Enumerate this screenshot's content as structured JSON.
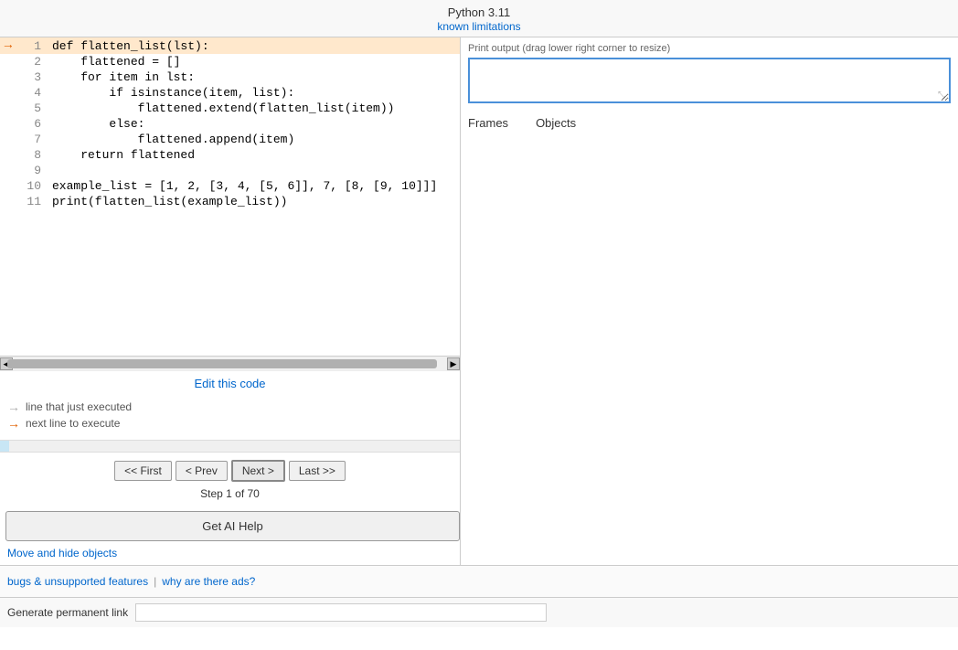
{
  "header": {
    "version": "Python 3.11",
    "known_limitations_link": "known limitations"
  },
  "code": {
    "lines": [
      {
        "num": 1,
        "code": "def flatten_list(lst):",
        "arrow": "→",
        "highlighted": true
      },
      {
        "num": 2,
        "code": "    flattened = []",
        "arrow": "",
        "highlighted": false
      },
      {
        "num": 3,
        "code": "    for item in lst:",
        "arrow": "",
        "highlighted": false
      },
      {
        "num": 4,
        "code": "        if isinstance(item, list):",
        "arrow": "",
        "highlighted": false
      },
      {
        "num": 5,
        "code": "            flattened.extend(flatten_list(item))",
        "arrow": "",
        "highlighted": false
      },
      {
        "num": 6,
        "code": "        else:",
        "arrow": "",
        "highlighted": false
      },
      {
        "num": 7,
        "code": "            flattened.append(item)",
        "arrow": "",
        "highlighted": false
      },
      {
        "num": 8,
        "code": "    return flattened",
        "arrow": "",
        "highlighted": false
      },
      {
        "num": 9,
        "code": "",
        "arrow": "",
        "highlighted": false
      },
      {
        "num": 10,
        "code": "example_list = [1, 2, [3, 4, [5, 6]], 7, [8, [9, 10]]]",
        "arrow": "",
        "highlighted": false
      },
      {
        "num": 11,
        "code": "print(flatten_list(example_list))",
        "arrow": "",
        "highlighted": false
      }
    ],
    "edit_link": "Edit this code"
  },
  "legend": {
    "executed_label": "line that just executed",
    "next_label": "next line to execute"
  },
  "navigation": {
    "first_label": "<< First",
    "prev_label": "< Prev",
    "next_label": "Next >",
    "last_label": "Last >>",
    "step_info": "Step 1 of 70"
  },
  "ai_help": {
    "button_label": "Get AI Help"
  },
  "move_hide": {
    "link_label": "Move and hide objects"
  },
  "right_panel": {
    "print_output_label": "Print output (drag lower right corner to resize)",
    "frames_tab": "Frames",
    "objects_tab": "Objects"
  },
  "bottom_bar": {
    "bugs_link": "bugs & unsupported features",
    "separator": "|",
    "ads_link": "why are there ads?"
  },
  "perm_link": {
    "label": "Generate permanent link",
    "input_placeholder": ""
  }
}
